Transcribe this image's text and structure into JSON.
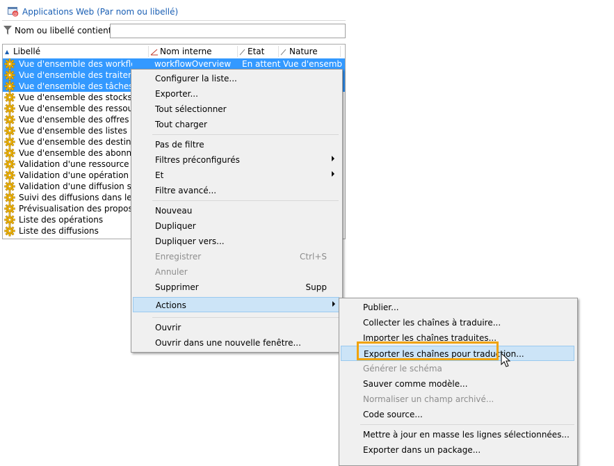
{
  "header": {
    "title": "Applications Web (Par nom ou libellé)"
  },
  "filter": {
    "label": "Nom ou libellé contient :",
    "value": ""
  },
  "grid": {
    "columns": [
      "Libellé",
      "Nom interne",
      "Etat",
      "Nature"
    ],
    "rows": [
      {
        "label": "Vue d'ensemble des workflows",
        "name": "workflowOverview",
        "state": "En attent...",
        "nature": "Vue d'ensemble",
        "selected": true
      },
      {
        "label": "Vue d'ensemble des traitements",
        "selected": true
      },
      {
        "label": "Vue d'ensemble des tâches",
        "selected": true
      },
      {
        "label": "Vue d'ensemble des stocks"
      },
      {
        "label": "Vue d'ensemble des ressources"
      },
      {
        "label": "Vue d'ensemble des offres"
      },
      {
        "label": "Vue d'ensemble des listes"
      },
      {
        "label": "Vue d'ensemble des destinataires"
      },
      {
        "label": "Vue d'ensemble des abonnements"
      },
      {
        "label": "Validation d'une ressource marketing"
      },
      {
        "label": "Validation d'une opération"
      },
      {
        "label": "Validation d'une diffusion sur une opération"
      },
      {
        "label": "Suivi des diffusions dans les opérations"
      },
      {
        "label": "Prévisualisation des propositions"
      },
      {
        "label": "Liste des opérations"
      },
      {
        "label": "Liste des diffusions"
      }
    ]
  },
  "context_menu": {
    "items": [
      {
        "label": "Configurer la liste..."
      },
      {
        "label": "Exporter..."
      },
      {
        "label": "Tout sélectionner"
      },
      {
        "label": "Tout charger"
      },
      {
        "label": "Pas de filtre"
      },
      {
        "label": "Filtres préconfigurés"
      },
      {
        "label": "Et"
      },
      {
        "label": "Filtre avancé..."
      },
      {
        "label": "Nouveau"
      },
      {
        "label": "Dupliquer"
      },
      {
        "label": "Dupliquer vers..."
      },
      {
        "label": "Enregistrer",
        "shortcut": "Ctrl+S"
      },
      {
        "label": "Annuler"
      },
      {
        "label": "Supprimer",
        "shortcut": "Supp"
      },
      {
        "label": "Actions"
      },
      {
        "label": "Ouvrir"
      },
      {
        "label": "Ouvrir dans une nouvelle fenêtre..."
      }
    ]
  },
  "actions_submenu": {
    "items": [
      {
        "label": "Publier..."
      },
      {
        "label": "Collecter les chaînes à traduire..."
      },
      {
        "label": "Importer les chaînes traduites..."
      },
      {
        "label": "Exporter les chaînes pour traduction..."
      },
      {
        "label": "Générer le schéma"
      },
      {
        "label": "Sauver comme modèle..."
      },
      {
        "label": "Normaliser un champ archivé..."
      },
      {
        "label": "Code source..."
      },
      {
        "label": "Mettre à jour en masse les lignes sélectionnées..."
      },
      {
        "label": "Exporter dans un package..."
      }
    ]
  }
}
